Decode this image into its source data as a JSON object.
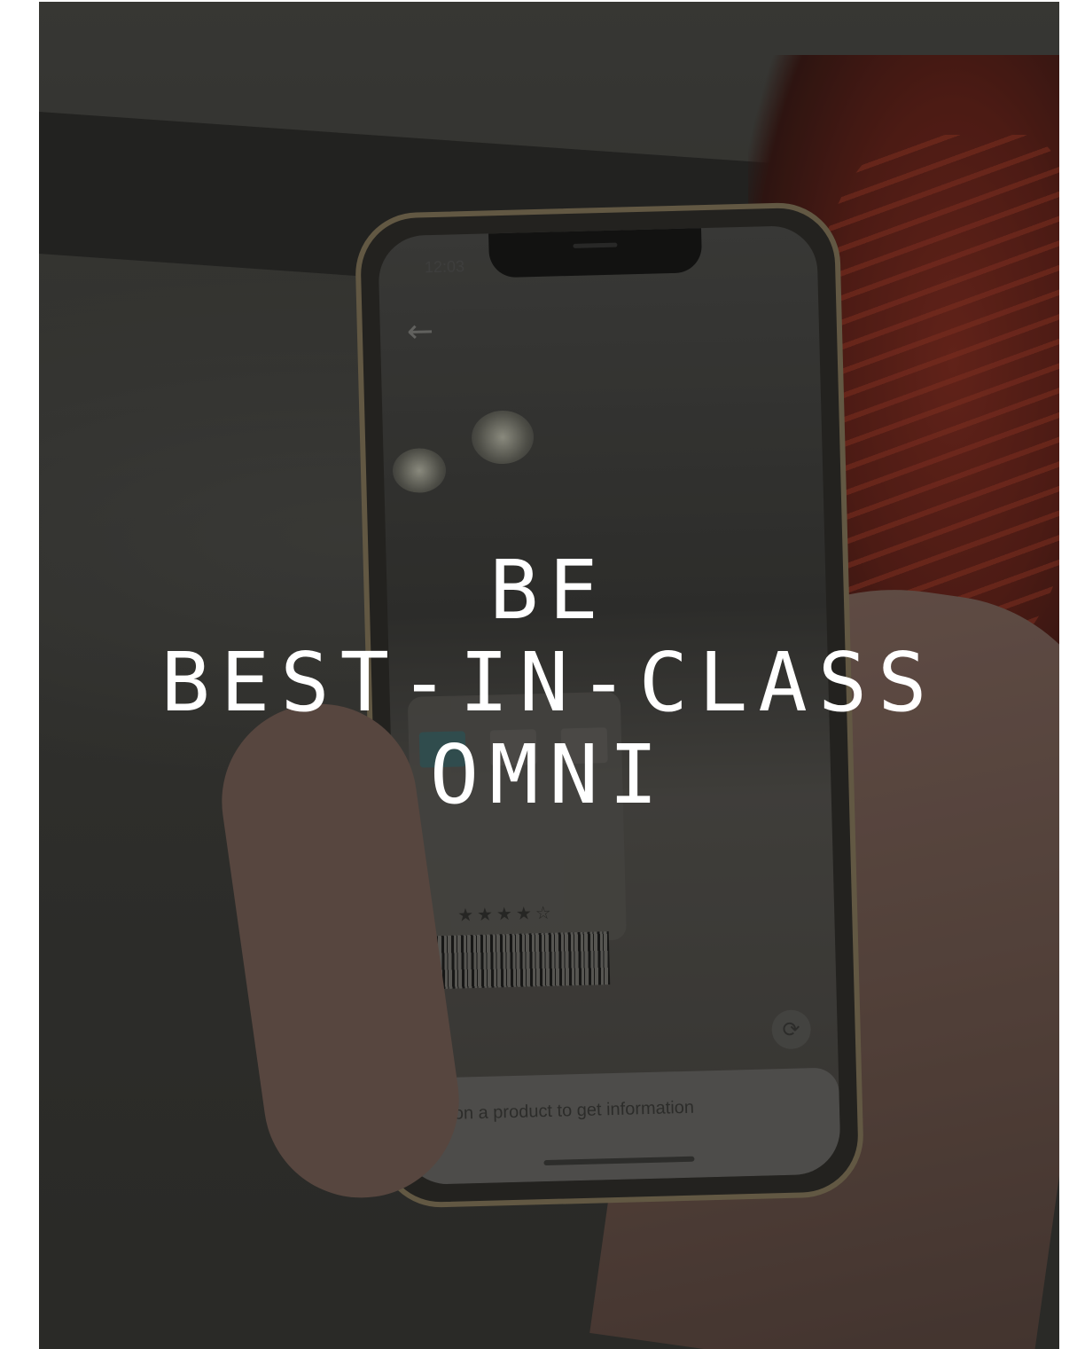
{
  "headline": {
    "line1": "BE",
    "line2": "BEST-IN-CLASS",
    "line3": "OMNI"
  },
  "phone_screen": {
    "status_time": "12:03",
    "back_icon": "back-arrow-icon",
    "refresh_icon": "refresh-icon",
    "bottom_sheet_text": "Tap on a product to get information"
  },
  "colors": {
    "headline_text": "#ffffff",
    "overlay": "rgba(20,20,18,0.35)",
    "shoe_accent": "#8a2a1e"
  }
}
